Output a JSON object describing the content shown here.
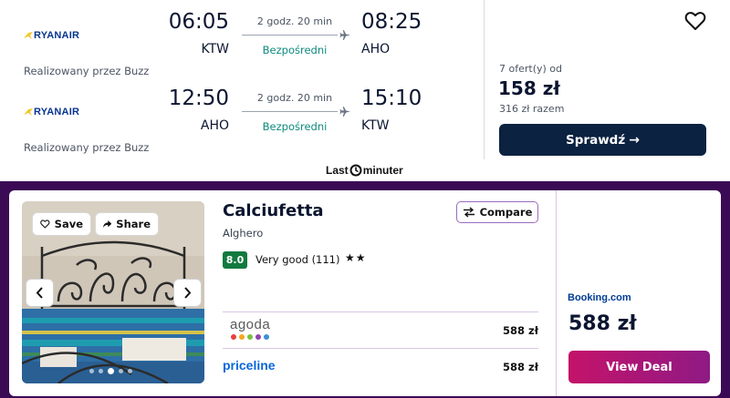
{
  "flight": {
    "legs": [
      {
        "airline": "RYANAIR",
        "operated_by": "Realizowany przez Buzz",
        "departure_time": "06:05",
        "departure_airport": "KTW",
        "arrival_time": "08:25",
        "arrival_airport": "AHO",
        "duration": "2 godz. 20 min",
        "stops": "Bezpośredni"
      },
      {
        "airline": "RYANAIR",
        "operated_by": "Realizowany przez Buzz",
        "departure_time": "12:50",
        "departure_airport": "AHO",
        "arrival_time": "15:10",
        "arrival_airport": "KTW",
        "duration": "2 godz. 20 min",
        "stops": "Bezpośredni"
      }
    ],
    "offers": "7 ofert(y) od",
    "price": "158 zł",
    "total": "316 zł razem",
    "check_button": "Sprawdź",
    "check_arrow": "→",
    "provider_left": "Last",
    "provider_right": "minuter"
  },
  "hotel": {
    "save_label": "Save",
    "share_label": "Share",
    "name": "Calciufetta",
    "location": "Alghero",
    "score": "8.0",
    "rating_text": "Very good (111)",
    "stars": "★★",
    "compare_label": "Compare",
    "providers": [
      {
        "name": "agoda",
        "price": "588 zł"
      },
      {
        "name": "priceline",
        "price": "588 zł"
      }
    ],
    "featured_provider": "Booking.com",
    "featured_price": "588 zł",
    "deal_button": "View Deal"
  },
  "colors": {
    "accent_dark": "#0b2241",
    "direct_green": "#0e8a7e",
    "hotel_frame": "#3b0a55",
    "score_green": "#137a3f",
    "deal_gradient_start": "#c4136a",
    "deal_gradient_end": "#8f1a84"
  },
  "icons": [
    "heart-icon",
    "airplane-icon",
    "share-arrow-icon",
    "chevron-left-icon",
    "chevron-right-icon",
    "compare-arrows-icon"
  ]
}
